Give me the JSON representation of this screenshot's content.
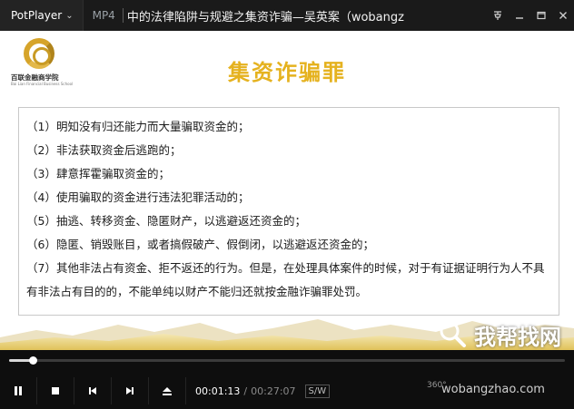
{
  "titlebar": {
    "app_name": "PotPlayer",
    "format": "MP4",
    "title": "中的法律陷阱与规避之集资诈骗—吴英案（wobangz",
    "buttons": [
      "pin-icon",
      "minimize-icon",
      "maximize-icon",
      "close-icon"
    ]
  },
  "slide": {
    "logo_cn": "百联金融商学院",
    "logo_en": "Bai Lian Financial Business School",
    "title": "集资诈骗罪",
    "lines": [
      "（1）明知没有归还能力而大量骗取资金的；",
      "（2）非法获取资金后逃跑的；",
      "（3）肆意挥霍骗取资金的；",
      "（4）使用骗取的资金进行违法犯罪活动的；",
      "（5）抽逃、转移资金、隐匿财产，以逃避返还资金的；",
      "（6）隐匿、销毁账目，或者搞假破产、假倒闭，以逃避返还资金的；",
      "（7）其他非法占有资金、拒不返还的行为。但是，在处理具体案件的时候，对于有证据证明行为人不具有非法占有目的的，不能单纯以财产不能归还就按金融诈骗罪处罚。"
    ]
  },
  "watermark": {
    "brand": "我帮找网",
    "url": "wobangzhao.com"
  },
  "player": {
    "progress": 0.042,
    "current_time": "00:01:13",
    "slash": "/",
    "duration": "00:27:07",
    "sw_label": "S/W",
    "right_info": "360°"
  },
  "colors": {
    "title_gold": "#e5b21f",
    "chrome_dark": "#1a1a1a"
  }
}
